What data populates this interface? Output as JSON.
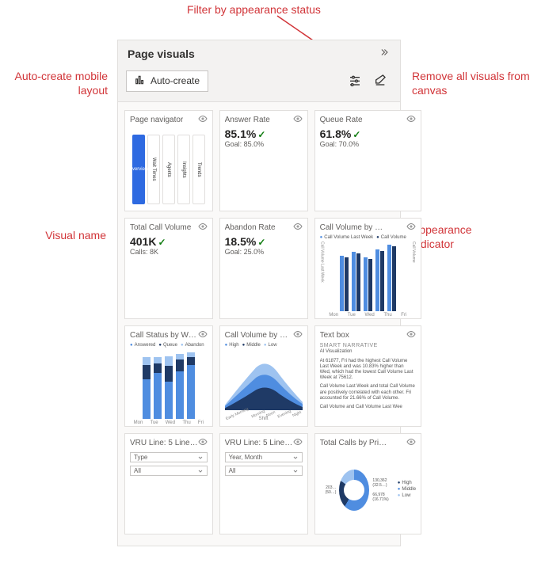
{
  "panel": {
    "title": "Page visuals",
    "auto_create_label": "Auto-create"
  },
  "annotations": {
    "auto_create": "Auto-create mobile layout",
    "filter": "Filter by appearance status",
    "remove": "Remove all visuals from canvas",
    "visual_name": "Visual name",
    "appearance_indicator": "Appearance indicator"
  },
  "cards": [
    {
      "title": "Page navigator",
      "type": "navigator",
      "nav_items": [
        "Overview",
        "Wait Times",
        "Agents",
        "Insights",
        "Trends"
      ]
    },
    {
      "title": "Answer Rate",
      "type": "kpi",
      "value": "85.1%",
      "goal": "Goal: 85.0%"
    },
    {
      "title": "Queue Rate",
      "type": "kpi",
      "value": "61.8%",
      "goal": "Goal: 70.0%"
    },
    {
      "title": "Total Call Volume",
      "type": "kpi",
      "value": "401K",
      "goal": "Calls: 8K"
    },
    {
      "title": "Abandon Rate",
      "type": "kpi",
      "value": "18.5%",
      "goal": "Goal: 25.0%"
    },
    {
      "title": "Call Volume by …",
      "type": "bars_single",
      "legend": [
        "Call Volume Last Week",
        "Call Volume"
      ],
      "x": [
        "Mon",
        "Tue",
        "Wed",
        "Thu",
        "Fri"
      ],
      "ylabels": [
        "Call Volume Last Week",
        "Call Volume"
      ]
    },
    {
      "title": "Call Status by W…",
      "type": "bars_stacked",
      "legend": [
        "Answered",
        "Queue",
        "Abandon"
      ],
      "x": [
        "Mon",
        "Tue",
        "Wed",
        "Thu",
        "Fri"
      ]
    },
    {
      "title": "Call Volume by S…",
      "type": "area",
      "legend": [
        "High",
        "Middle",
        "Low"
      ],
      "x": [
        "Early Morning",
        "Morning",
        "Noon",
        "Evening",
        "Night"
      ],
      "xlabel": "Shift"
    },
    {
      "title": "Text box",
      "type": "narrative",
      "heading": "SMART NARRATIVE",
      "sub": "AI Visualization",
      "body1": "At 61877, Fri had the highest Call Volume Last Week and was 10.83% higher than Wed, which had the lowest Call Volume Last Week at 75612.",
      "body2": "Call Volume Last Week and total Call Volume are positively correlated with each other. Fri accounted for 21.66% of Call Volume.",
      "body3": "Call Volume and Call Volume Last Wee"
    },
    {
      "title": "VRU Line: 5 Line…",
      "type": "slicer",
      "field": "Type",
      "value": "All"
    },
    {
      "title": "VRU Line: 5 Line…",
      "type": "slicer",
      "field": "Year, Month",
      "value": "All"
    },
    {
      "title": "Total Calls by Pri…",
      "type": "donut",
      "legend": [
        "High",
        "Middle",
        "Low"
      ],
      "labels": [
        "130,362 (32.5…)",
        "203… (50…)",
        "66,978 (16.71%)"
      ]
    }
  ],
  "chart_data": [
    {
      "id": "call_volume_by_day",
      "type": "bar",
      "categories": [
        "Mon",
        "Tue",
        "Wed",
        "Thu",
        "Fri"
      ],
      "series": [
        {
          "name": "Call Volume Last Week",
          "values": [
            75,
            78,
            72,
            80,
            85
          ]
        },
        {
          "name": "Call Volume",
          "values": [
            74,
            77,
            70,
            79,
            83
          ]
        }
      ],
      "ylim": [
        0,
        100
      ]
    },
    {
      "id": "call_status_by_week",
      "type": "bar",
      "stacked": true,
      "categories": [
        "Mon",
        "Tue",
        "Wed",
        "Thu",
        "Fri"
      ],
      "series": [
        {
          "name": "Answered",
          "values": [
            55,
            62,
            50,
            65,
            72
          ]
        },
        {
          "name": "Queue",
          "values": [
            18,
            12,
            20,
            15,
            10
          ]
        },
        {
          "name": "Abandon",
          "values": [
            10,
            8,
            12,
            7,
            6
          ]
        }
      ]
    },
    {
      "id": "call_volume_by_shift",
      "type": "area",
      "categories": [
        "Early Morning",
        "Morning",
        "Noon",
        "Evening",
        "Night"
      ],
      "series": [
        {
          "name": "High",
          "values": [
            10,
            30,
            55,
            35,
            12
          ]
        },
        {
          "name": "Middle",
          "values": [
            8,
            22,
            40,
            25,
            9
          ]
        },
        {
          "name": "Low",
          "values": [
            5,
            12,
            22,
            14,
            5
          ]
        }
      ],
      "xlabel": "Shift"
    },
    {
      "id": "total_calls_by_priority",
      "type": "pie",
      "series": [
        {
          "name": "High",
          "value": 130362,
          "pct": 32.5
        },
        {
          "name": "Middle",
          "value": 203000,
          "pct": 50.8
        },
        {
          "name": "Low",
          "value": 66978,
          "pct": 16.71
        }
      ]
    }
  ]
}
